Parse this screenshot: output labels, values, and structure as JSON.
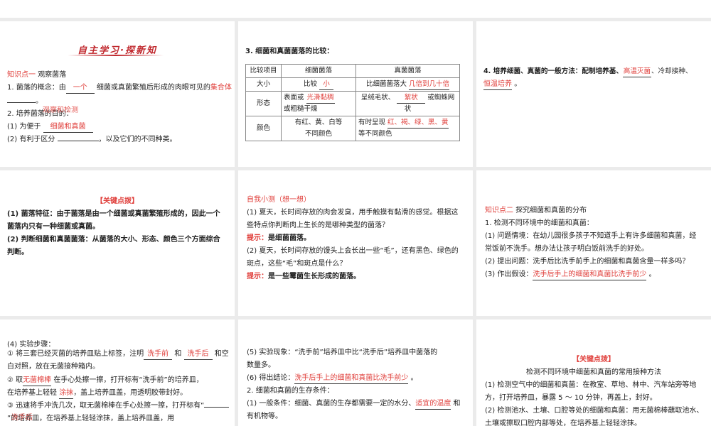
{
  "p1": {
    "title": "自主学习·探新知",
    "kp_label": "知识点一",
    "kp_title": "观察菌落",
    "l1a": "1. 菌落的概念：由",
    "a1": "一个",
    "l1b": "细菌或真菌繁殖后形成的肉眼可见的",
    "a2": "集合体",
    "l1c": "。",
    "l2": "2. 培养菌落的目的：",
    "a3": "观察和检测",
    "l3a": "(1) 为便于",
    "a4": "细菌和真菌",
    "l4a": "(2) 有利于区分",
    "l4b": "，以及它们的不同种类。"
  },
  "p2": {
    "heading": "3. 细菌和真菌菌落的比较：",
    "headers": [
      "比较项目",
      "细菌菌落",
      "真菌菌落"
    ],
    "r1": [
      "大小",
      "比较",
      "小",
      "比细菌菌落大",
      "几倍到几十倍"
    ],
    "r2": [
      "形态",
      "表面或",
      "光滑黏稠",
      "或粗糙干燥",
      "呈绒毛状、",
      "絮状",
      "或蜘蛛网状"
    ],
    "r3": [
      "颜色",
      "有红、黄、白等",
      "不同颜色",
      "有时呈现",
      "红、褐、绿、黑、黄",
      "等不同颜色"
    ]
  },
  "p3": {
    "l1": "4. 培养细菌、真菌的一般方法：配制培养基、",
    "a1": "高温灭菌",
    "l1b": "、冷却接种、",
    "a2": "恒温培养",
    "end": "。"
  },
  "p4": {
    "heading": "【关键点拨】",
    "l1": "(1) 菌落特征：由于菌落是由一个细菌或真菌繁殖形成的，因此一个",
    "l2": "菌落内只有一种细菌或真菌。",
    "l3": "(2) 判断细菌和真菌菌落：从菌落的大小、形态、颜色三个方面综合",
    "l4": "判断。"
  },
  "p5": {
    "heading": "自我小测（想一想）",
    "q1a": "(1) 夏天，长时间存放的肉会发臭，用手触摸有黏滑的感觉。根据这",
    "q1b": "些特点你判断肉上生长的是哪种类型的菌落？",
    "hint": "提示：",
    "a1": "是细菌菌落。",
    "q2a": "(2) 夏天，长时间存放的馒头上会长出一些“毛”，还有黑色、绿色的",
    "q2b": "斑点，这些“毛”和斑点是什么？",
    "a2": "是一些霉菌生长形成的菌落。"
  },
  "p6": {
    "kp_label": "知识点二",
    "kp_title": "探究细菌和真菌的分布",
    "l1": "1. 检测不同环境中的细菌和真菌：",
    "l2": "(1) 问题情境：在幼儿园很多孩子不知道手上有许多细菌和真菌，经",
    "l3": "常饭前不洗手。想办法让孩子明白饭前洗手的好处。",
    "l4": "(2) 提出问题：洗手后比洗手前手上的细菌和真菌含量一样多吗？",
    "l5": "(3) 作出假设：",
    "a1": "洗手后手上的细菌和真菌比洗手前少",
    "end": "。"
  },
  "p7": {
    "l1": "(4) 实验步骤：",
    "l2a": "① 将三套已经灭菌的培养皿贴上标签，注明",
    "a1": "洗手前",
    "sep": "和",
    "a2": "洗手后",
    "l2b": "和空",
    "l3": "白对照，放在无菌接种箱内。",
    "l4a": "② 取",
    "a3": "无菌棉棒",
    "l4b": "在手心处擦一擦，打开标有“洗手前”的培养皿，",
    "l5a": "在培养基上轻轻",
    "a4": "涂抹",
    "l5b": "，盖上培养皿盖，用透明胶带封好。",
    "l6": "③ 迅速将手冲洗几次，取无菌棉棒在手心处擦一擦，打开标有“",
    "a5": "洗手后",
    "l7": "”的培养皿，在培养基上轻轻涂抹，盖上培养皿盖，用"
  },
  "p8": {
    "l1": "(5) 实验现象：“洗手前”培养皿中比“洗手后”培养皿中菌落的",
    "l2": "数量多。",
    "l3": "(6) 得出结论：",
    "a1": "洗手后手上的细菌和真菌比洗手前少",
    "end": "。",
    "l4": "2. 细菌和真菌的生存条件：",
    "l5": "(1) 一般条件：细菌、真菌的生存都需要一定的水分、",
    "a2": "适宜的温度",
    "l5b": "和",
    "l6": "有机物等。"
  },
  "p9": {
    "heading": "【关键点拨】",
    "sub": "检测不同环境中细菌和真菌的常用接种方法",
    "l1": "(1) 检测空气中的细菌和真菌：在教室、草地、林中、汽车站旁等地",
    "l2": "方，打开培养皿，暴露 5 ～ 10 分钟，再盖上，封好。",
    "l3": "(2) 检测池水、土壤、口腔等处的细菌和真菌：用无菌棉棒蘸取池水、",
    "l4": "土壤或擦取口腔内部等处，在培养基上轻轻涂抹。"
  }
}
